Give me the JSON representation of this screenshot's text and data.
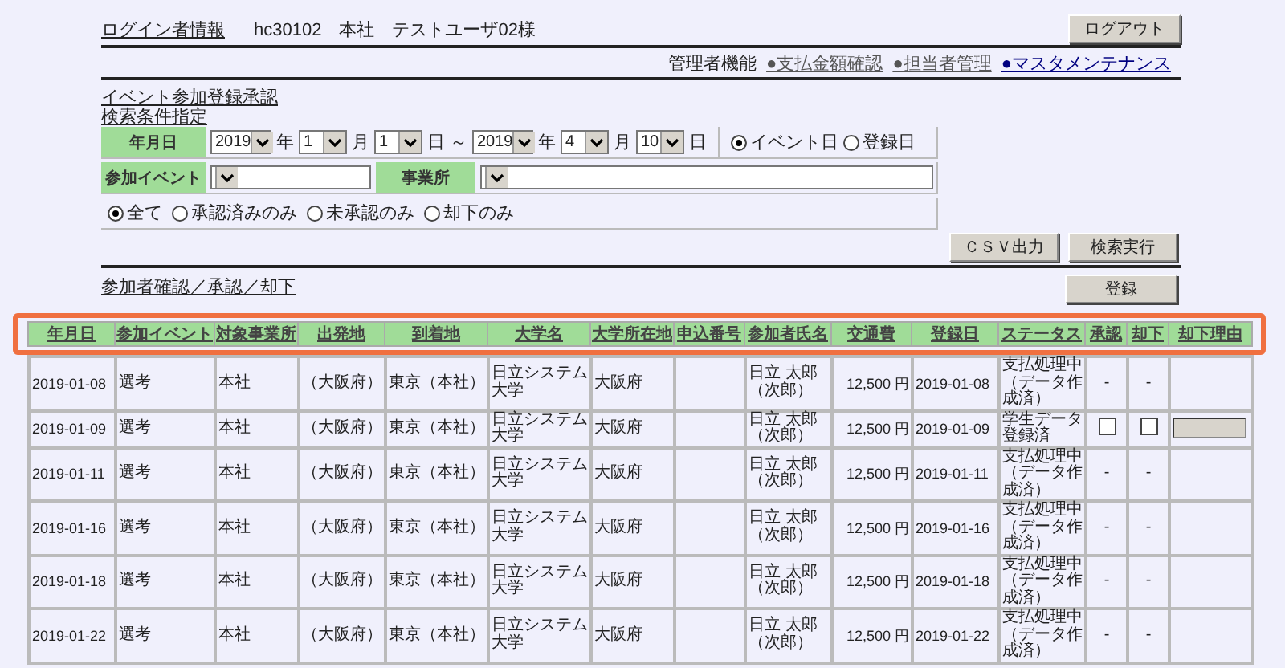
{
  "header": {
    "login_label": "ログイン者情報",
    "user": "hc30102　本社　テストユーザ02様",
    "logout": "ログアウト"
  },
  "admin_nav": {
    "label": "管理者機能",
    "links": [
      {
        "text": "●支払金額確認",
        "color": "#555555"
      },
      {
        "text": "●担当者管理",
        "color": "#555555"
      },
      {
        "text": "●マスタメンテナンス",
        "color": "#000080"
      }
    ]
  },
  "page_title": "イベント参加登録承認",
  "search_title": "検索条件指定",
  "search": {
    "date_label": "年月日",
    "from": {
      "year": "2019",
      "year_unit": "年",
      "month": "1",
      "month_unit": "月",
      "day": "1",
      "day_unit": "日"
    },
    "range_sep": "～",
    "to": {
      "year": "2019",
      "year_unit": "年",
      "month": "4",
      "month_unit": "月",
      "day": "10",
      "day_unit": "日"
    },
    "date_type": [
      {
        "label": "イベント日",
        "selected": true
      },
      {
        "label": "登録日",
        "selected": false
      }
    ],
    "event_label": "参加イベント",
    "office_label": "事業所",
    "status_filter": [
      {
        "label": "全て",
        "selected": true
      },
      {
        "label": "承認済みのみ",
        "selected": false
      },
      {
        "label": "未承認のみ",
        "selected": false
      },
      {
        "label": "却下のみ",
        "selected": false
      }
    ]
  },
  "buttons": [
    "ＣＳＶ出力",
    "検索実行"
  ],
  "section_title": "参加者確認／承認／却下",
  "register_button": "登録",
  "table": {
    "header_highlighted": true,
    "columns": [
      "年月日",
      "参加イベント",
      "対象事業所",
      "出発地",
      "到着地",
      "大学名",
      "大学所在地",
      "申込番号",
      "参加者氏名",
      "交通費",
      "登録日",
      "ステータス",
      "承認",
      "却下",
      "却下理由"
    ],
    "rows": [
      {
        "kind": "locked",
        "cells": [
          "2019-01-08",
          "選考",
          "本社",
          "（大阪府）",
          "東京（本社）",
          "日立システム大学",
          "大阪府",
          "",
          "日立 太郎（次郎）",
          "12,500 円",
          "2019-01-08",
          "支払処理中（データ作成済）"
        ],
        "approve": "-",
        "reject": "-"
      },
      {
        "kind": "editable",
        "cells": [
          "2019-01-09",
          "選考",
          "本社",
          "（大阪府）",
          "東京（本社）",
          "日立システム大学",
          "大阪府",
          "",
          "日立 太郎（次郎）",
          "12,500 円",
          "2019-01-09",
          "学生データ登録済"
        ],
        "approve_checked": false,
        "reject_checked": false
      },
      {
        "kind": "locked",
        "cells": [
          "2019-01-11",
          "選考",
          "本社",
          "（大阪府）",
          "東京（本社）",
          "日立システム大学",
          "大阪府",
          "",
          "日立 太郎（次郎）",
          "12,500 円",
          "2019-01-11",
          "支払処理中（データ作成済）"
        ],
        "approve": "-",
        "reject": "-"
      },
      {
        "kind": "locked",
        "cells": [
          "2019-01-16",
          "選考",
          "本社",
          "（大阪府）",
          "東京（本社）",
          "日立システム大学",
          "大阪府",
          "",
          "日立 太郎（次郎）",
          "12,500 円",
          "2019-01-16",
          "支払処理中（データ作成済）"
        ],
        "approve": "-",
        "reject": "-"
      },
      {
        "kind": "locked",
        "cells": [
          "2019-01-18",
          "選考",
          "本社",
          "（大阪府）",
          "東京（本社）",
          "日立システム大学",
          "大阪府",
          "",
          "日立 太郎（次郎）",
          "12,500 円",
          "2019-01-18",
          "支払処理中（データ作成済）"
        ],
        "approve": "-",
        "reject": "-"
      },
      {
        "kind": "locked",
        "cells": [
          "2019-01-22",
          "選考",
          "本社",
          "（大阪府）",
          "東京（本社）",
          "日立システム大学",
          "大阪府",
          "",
          "日立 太郎（次郎）",
          "12,500 円",
          "2019-01-22",
          "支払処理中（データ作成済）"
        ],
        "approve": "-",
        "reject": "-"
      }
    ]
  }
}
